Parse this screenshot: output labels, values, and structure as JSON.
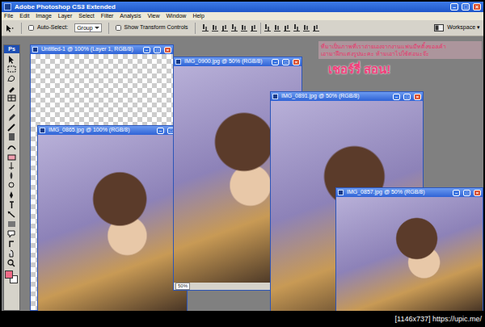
{
  "app": {
    "title": "Adobe Photoshop CS3 Extended"
  },
  "controls": [
    "–",
    "□",
    "×"
  ],
  "menu": [
    "File",
    "Edit",
    "Image",
    "Layer",
    "Select",
    "Filter",
    "Analysis",
    "View",
    "Window",
    "Help"
  ],
  "options_bar": {
    "auto_select": {
      "label": "Auto-Select:",
      "checked": false
    },
    "auto_select_target": "Group",
    "show_transform": {
      "label": "Show Transform Controls",
      "checked": false
    },
    "workspace": "Workspace ▾"
  },
  "tools": {
    "logo": "Ps",
    "swatches": [
      {
        "name": "foreground",
        "color": "#f06a86"
      },
      {
        "name": "background",
        "color": "#ffffff"
      }
    ]
  },
  "documents": [
    {
      "title": "Untitled-1 @ 100% (Layer 1, RGB/8)",
      "kind": "canvas"
    },
    {
      "title": "IMG_0865.jpg @ 100% (RGB/8)",
      "kind": "photo"
    },
    {
      "title": "IMG_0900.jpg @ 50% (RGB/8)",
      "kind": "photo",
      "status": "50%"
    },
    {
      "title": "IMG_0891.jpg @ 50% (RGB/8)",
      "kind": "photo"
    },
    {
      "title": "IMG_0857.jpg @ 50% (RGB/8)",
      "kind": "photo"
    }
  ],
  "overlay": {
    "lines": [
      "ที่มาเป็นภาพที่เราถ่ายเองจากงานแฟนมีทติ้งของเค้า",
      "เอามาฝึกแต่งรูปนะคะ ห้ามเอาไปใช้ต่อนะจ๊ะ"
    ],
    "heading": "เชอร์รี่ สอน!"
  },
  "footer": "[1146x737] https://upic.me/"
}
